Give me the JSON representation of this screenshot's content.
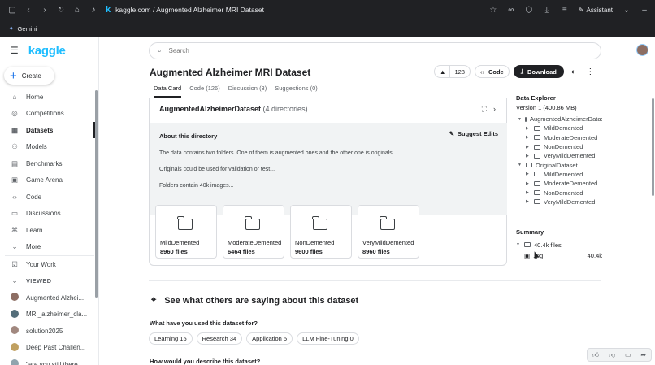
{
  "browser": {
    "url": "kaggle.com / Augmented Alzheimer MRI Dataset",
    "assistant_label": "Assistant",
    "bookmark": "Gemini",
    "favicon": "k"
  },
  "sidebar": {
    "logo": "kaggle",
    "create_label": "Create",
    "items": [
      {
        "label": "Home",
        "icon": "home-icon",
        "glyph": "⌂"
      },
      {
        "label": "Competitions",
        "icon": "trophy-icon",
        "glyph": "◎"
      },
      {
        "label": "Datasets",
        "icon": "table-icon",
        "glyph": "▦"
      },
      {
        "label": "Models",
        "icon": "models-icon",
        "glyph": "⚇"
      },
      {
        "label": "Benchmarks",
        "icon": "benchmark-icon",
        "glyph": "▤"
      },
      {
        "label": "Game Arena",
        "icon": "game-icon",
        "glyph": "▣"
      },
      {
        "label": "Code",
        "icon": "code-icon",
        "glyph": "‹›"
      },
      {
        "label": "Discussions",
        "icon": "discussion-icon",
        "glyph": "▭"
      },
      {
        "label": "Learn",
        "icon": "learn-icon",
        "glyph": "⌘"
      },
      {
        "label": "More",
        "icon": "chevron-down-icon",
        "glyph": "⌄"
      }
    ],
    "your_work": "Your Work",
    "viewed_label": "VIEWED",
    "viewed": [
      {
        "label": "Augmented Alzhei...",
        "color": "#8d6e63"
      },
      {
        "label": "MRI_alzheimer_cla...",
        "color": "#546e7a"
      },
      {
        "label": "solution2025",
        "color": "#a1887f"
      },
      {
        "label": "Deep Past Challen...",
        "color": "#c0a060"
      },
      {
        "label": "\"are you still there...",
        "color": "#90a4ae"
      }
    ]
  },
  "search": {
    "placeholder": "Search"
  },
  "dataset": {
    "title": "Augmented Alzheimer MRI Dataset",
    "upvotes": "128",
    "code_button": "Code",
    "download_button": "Download",
    "tabs": [
      "Data Card",
      "Code (126)",
      "Discussion (3)",
      "Suggestions (0)"
    ]
  },
  "directory": {
    "name": "AugmentedAlzheimerDataset",
    "count": "(4 directories)",
    "about_title": "About this directory",
    "suggest_edits": "Suggest Edits",
    "lines": [
      "The data contains two folders. One of them is augmented ones and the other one is originals.",
      "Originals could be used for validation or test...",
      "Folders contain 40k images..."
    ],
    "folders": [
      {
        "name": "MildDemented",
        "files": "8960 files"
      },
      {
        "name": "ModerateDemented",
        "files": "6464 files"
      },
      {
        "name": "NonDemented",
        "files": "9600 files"
      },
      {
        "name": "VeryMildDemented",
        "files": "8960 files"
      }
    ]
  },
  "discussion": {
    "title": "See what others are saying about this dataset",
    "q1": "What have you used this dataset for?",
    "chips": [
      "Learning 15",
      "Research 34",
      "Application 5",
      "LLM Fine-Tuning 0"
    ],
    "q2": "How would you describe this dataset?"
  },
  "explorer": {
    "title": "Data Explorer",
    "version": "Version 1",
    "size": "(400.86 MB)",
    "tree": [
      {
        "label": "AugmentedAlzheimerDataset",
        "level": 0,
        "open": true
      },
      {
        "label": "MildDemented",
        "level": 1
      },
      {
        "label": "ModerateDemented",
        "level": 1
      },
      {
        "label": "NonDemented",
        "level": 1
      },
      {
        "label": "VeryMildDemented",
        "level": 1
      },
      {
        "label": "OriginalDataset",
        "level": 0,
        "open": true
      },
      {
        "label": "MildDemented",
        "level": 1
      },
      {
        "label": "ModerateDemented",
        "level": 1
      },
      {
        "label": "NonDemented",
        "level": 1
      },
      {
        "label": "VeryMildDemented",
        "level": 1
      }
    ]
  },
  "summary": {
    "title": "Summary",
    "files": "40.4k files",
    "ext": ".jpg",
    "ext_count": "40.4k"
  }
}
